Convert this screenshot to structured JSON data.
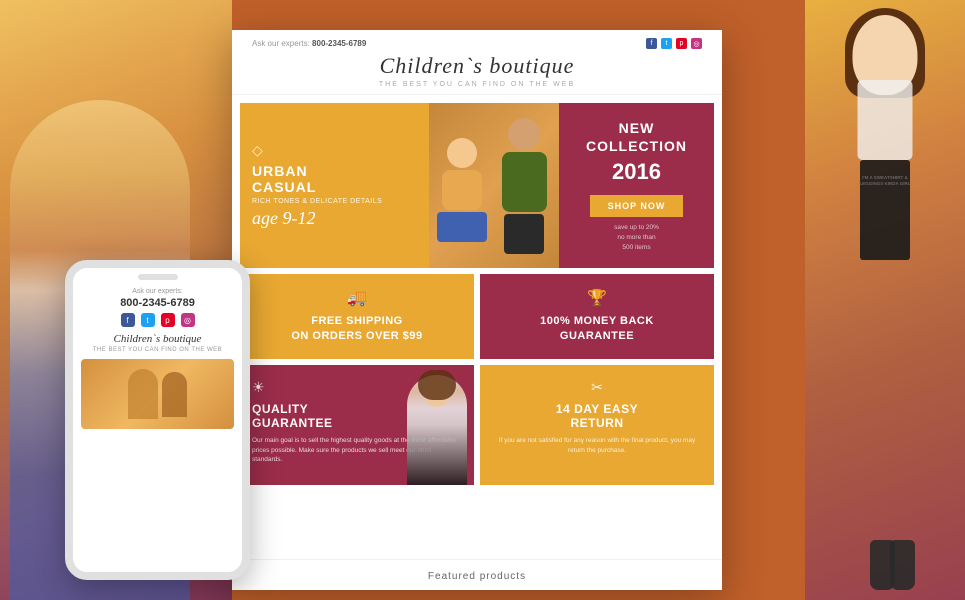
{
  "background": {
    "left_gradient_start": "#f0c060",
    "left_gradient_end": "#803555",
    "right_gradient_start": "#e8b040",
    "right_gradient_end": "#984050"
  },
  "header": {
    "ask_experts_label": "Ask our experts:",
    "phone": "800-2345-6789",
    "title": "Children`s boutique",
    "subtitle": "THE BEST YOU CAN FIND ON THE WEB",
    "social_icons": [
      "f",
      "t",
      "p",
      "ig"
    ]
  },
  "hero": {
    "tag_urban": "URBAN",
    "tag_casual": "CASUAL",
    "desc": "RICH TONES & DELICATE DETAILS",
    "age": "age 9-12",
    "new_collection": "NEW COLLECTION",
    "year": "2016",
    "shop_now": "shop now",
    "save_desc": "save up to 20%",
    "no_more": "no more than",
    "items": "500 items"
  },
  "features": {
    "shipping": {
      "icon": "🚚",
      "title": "Free shipping",
      "subtitle": "on orders over $99"
    },
    "money_back": {
      "icon": "💰",
      "title": "100% money back",
      "subtitle": "GUARANTEE"
    },
    "quality": {
      "icon": "☀",
      "title": "QUALITY",
      "subtitle": "GUARANTEE",
      "text": "Our main goal is to sell the highest quality goods at the most affordable prices possible. Make sure the products we sell meet our strict standards."
    },
    "return": {
      "icon": "✂",
      "title": "14 day easy",
      "subtitle": "return",
      "text": "If you are not satisfied for any reason with the final product, you may return the purchase."
    }
  },
  "footer": {
    "featured_label": "Featured products"
  },
  "mobile": {
    "ask": "Ask our experts:",
    "phone": "800-2345-6789",
    "title": "Children`s boutique",
    "subtitle": "THE BEST YOU CAN FIND ON THE WEB"
  }
}
